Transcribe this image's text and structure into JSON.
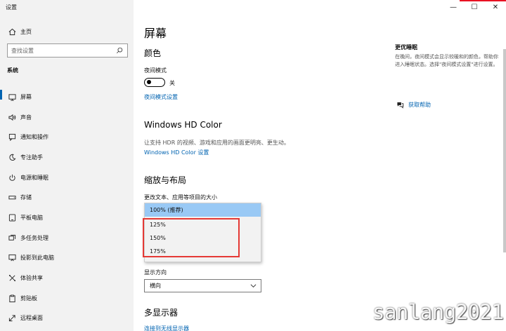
{
  "window": {
    "title": "设置",
    "minimize": "—",
    "maximize": "☐",
    "close": "✕",
    "accent": "#e81123"
  },
  "sidebar": {
    "home_label": "主页",
    "search_placeholder": "查找设置",
    "section": "系统",
    "items": [
      {
        "label": "屏幕",
        "icon": "monitor-icon"
      },
      {
        "label": "声音",
        "icon": "speaker-icon"
      },
      {
        "label": "通知和操作",
        "icon": "notification-icon"
      },
      {
        "label": "专注助手",
        "icon": "moon-icon"
      },
      {
        "label": "电源和睡眠",
        "icon": "power-icon"
      },
      {
        "label": "存储",
        "icon": "storage-icon"
      },
      {
        "label": "平板电脑",
        "icon": "tablet-icon"
      },
      {
        "label": "多任务处理",
        "icon": "multitask-icon"
      },
      {
        "label": "投影到此电脑",
        "icon": "projection-icon"
      },
      {
        "label": "体验共享",
        "icon": "share-icon"
      },
      {
        "label": "剪贴板",
        "icon": "clipboard-icon"
      },
      {
        "label": "远程桌面",
        "icon": "remote-desktop-icon"
      }
    ],
    "active_index": 0,
    "accent": "#0063b1"
  },
  "main": {
    "title": "屏幕",
    "color_section": {
      "heading": "颜色",
      "night_light_label": "夜间模式",
      "toggle_state": "关",
      "settings_link": "夜间模式设置"
    },
    "hdr_section": {
      "heading": "Windows HD Color",
      "desc": "让支持 HDR 的视频、游戏和应用的画面更明亮、更生动。",
      "link": "Windows HD Color 设置"
    },
    "scale_section": {
      "heading": "缩放与布局",
      "size_label": "更改文本、应用等项目的大小",
      "options": [
        "100% (推荐)",
        "125%",
        "150%",
        "175%"
      ],
      "selected_index": 0
    },
    "orientation": {
      "label": "显示方向",
      "value": "横向"
    },
    "multi_display": {
      "heading": "多显示器",
      "link": "连接到无线显示器"
    }
  },
  "right_panel": {
    "heading": "更优睡眠",
    "desc": "在晚间，夜间模式会显示较暖和的颜色，帮助你进入睡眠状态。选择\"夜间模式设置\"进行设置。",
    "help_link": "获取帮助"
  },
  "watermark": "sanlang2021"
}
